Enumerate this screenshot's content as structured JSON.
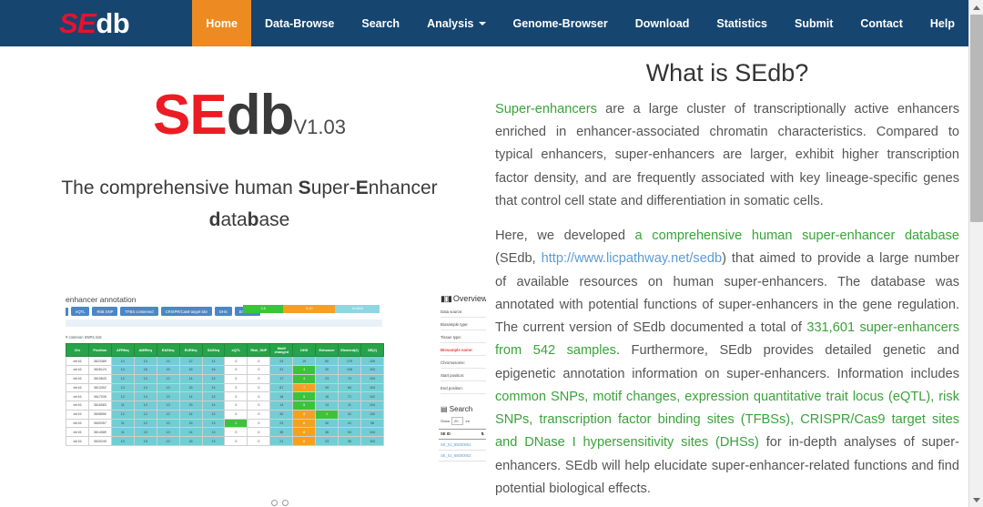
{
  "navbar": {
    "brand": {
      "part1": "SE",
      "part2": "db"
    },
    "items": [
      {
        "label": "Home",
        "active": true,
        "caret": false
      },
      {
        "label": "Data-Browse",
        "active": false,
        "caret": false
      },
      {
        "label": "Search",
        "active": false,
        "caret": false
      },
      {
        "label": "Analysis",
        "active": false,
        "caret": true
      },
      {
        "label": "Genome-Browser",
        "active": false,
        "caret": false
      },
      {
        "label": "Download",
        "active": false,
        "caret": false
      },
      {
        "label": "Statistics",
        "active": false,
        "caret": false
      },
      {
        "label": "Submit",
        "active": false,
        "caret": false
      },
      {
        "label": "Contact",
        "active": false,
        "caret": false
      },
      {
        "label": "Help",
        "active": false,
        "caret": false
      }
    ],
    "colors": {
      "background": "#164570",
      "active": "#ed8b22",
      "brand_red": "#e8112d"
    }
  },
  "hero": {
    "logo": {
      "se": "SE",
      "db": "db",
      "version": "V1.03"
    },
    "tagline_line1_a": "The comprehensive human ",
    "tagline_line1_s": "S",
    "tagline_line1_b": "uper-",
    "tagline_line1_e": "E",
    "tagline_line1_c": "nhancer",
    "tagline_line2_d": "d",
    "tagline_line2_a": "ata",
    "tagline_line2_b": "b",
    "tagline_line2_c": "ase",
    "colors": {
      "se_red": "#ec1c24",
      "db_dark": "#3a3a3a"
    }
  },
  "carousel_shot": {
    "title": "enhancer annotation",
    "tabs": [
      "eQTL",
      "Risk SNP",
      "TFBS conserved",
      "CRISPR/Cas9 target site",
      "DHS",
      "Enhancer"
    ],
    "legend": [
      {
        "label": "0-5",
        "color": "#3bc43b"
      },
      {
        "label": "5-10",
        "color": "#f5a020"
      },
      {
        "label": "10-MAX",
        "color": "#8fd6e2"
      }
    ],
    "subtitle": "# common SNPs:416",
    "table": {
      "headers": [
        "Chr",
        "Position",
        "AFRfeq",
        "AMRfeq",
        "EASfeq",
        "EURfeq",
        "SASfeq",
        "eQTL",
        "Risk_SNP",
        "Motif changed",
        "DHS",
        "Enhancer",
        "Element(#)",
        "SE(#)"
      ],
      "rows": [
        [
          "chr16",
          "3623389",
          "14",
          "14",
          "14",
          "12",
          "14",
          "0",
          "0",
          "24",
          "19",
          "60",
          "179",
          "109"
        ],
        [
          "chr16",
          "3626123",
          "14",
          "16",
          "15",
          "16",
          "16",
          "0",
          "0",
          "31",
          "4",
          "30",
          "148",
          "103"
        ],
        [
          "chr16",
          "3615843",
          "12",
          "13",
          "12",
          "14",
          "13",
          "0",
          "0",
          "17",
          "4",
          "23",
          "74",
          "104"
        ],
        [
          "chr16",
          "3613302",
          "13",
          "14",
          "13",
          "15",
          "14",
          "0",
          "0",
          "67",
          "7",
          "39",
          "84",
          "104"
        ],
        [
          "chr16",
          "3617035",
          "12",
          "14",
          "13",
          "14",
          "13",
          "0",
          "0",
          "18",
          "5",
          "18",
          "71",
          "102"
        ],
        [
          "chr16",
          "3616083",
          "11",
          "13",
          "13",
          "15",
          "14",
          "0",
          "0",
          "14",
          "5",
          "14",
          "11",
          "104"
        ],
        [
          "chr16",
          "3608550",
          "12",
          "12",
          "12",
          "14",
          "12",
          "0",
          "0",
          "40",
          "8",
          "1",
          "41",
          "100"
        ],
        [
          "chr16",
          "3609357",
          "11",
          "12",
          "13",
          "15",
          "13",
          "2",
          "0",
          "23",
          "8",
          "30",
          "41",
          "98"
        ],
        [
          "chr16",
          "3614089",
          "11",
          "13",
          "13",
          "14",
          "13",
          "0",
          "0",
          "35",
          "8",
          "36",
          "94",
          "104"
        ],
        [
          "chr16",
          "3620249",
          "10",
          "15",
          "13",
          "16",
          "13",
          "0",
          "0",
          "21",
          "6",
          "23",
          "96",
          "104"
        ]
      ]
    },
    "overview": {
      "title": "Overview",
      "fields": [
        "Data source:",
        "Biosample type:",
        "Tissue type:",
        "Biosample name:",
        "Chromosome:",
        "Start position:",
        "End position:"
      ],
      "highlight_field": "Biosample name:"
    },
    "search_panel": {
      "title": "Search",
      "show_label": "Show",
      "show_value": "20",
      "entries_label": "en",
      "column_header": "SE ID",
      "rows": [
        "SE_01_85000001",
        "SE_01_85000002"
      ]
    }
  },
  "article": {
    "title": "What is SEdb?",
    "p1": [
      {
        "t": "Super-enhancers",
        "c": "green"
      },
      {
        "t": " are a large cluster of transcriptionally active enhancers enriched in enhancer-associated chromatin characteristics. Compared to typical enhancers, super-enhancers are larger, exhibit higher transcription factor density, and are frequently associated with key lineage-specific genes that control cell state and differentiation in somatic cells.",
        "c": "plain"
      }
    ],
    "p2": [
      {
        "t": "Here, we developed ",
        "c": "plain"
      },
      {
        "t": "a comprehensive human super-enhancer database",
        "c": "green"
      },
      {
        "t": " (SEdb, ",
        "c": "plain"
      },
      {
        "t": "http://www.licpathway.net/sedb",
        "c": "link"
      },
      {
        "t": ") that aimed to provide a large number of available resources on human super-enhancers. The database was annotated with potential functions of super-enhancers in the gene regulation. The current version of SEdb documented a total of ",
        "c": "plain"
      },
      {
        "t": "331,601 super-enhancers from 542 samples",
        "c": "green"
      },
      {
        "t": ". Furthermore, SEdb provides detailed genetic and epigenetic annotation information on super-enhancers. Information includes ",
        "c": "plain"
      },
      {
        "t": "common SNPs, motif changes, expression quantitative trait locus (eQTL), risk SNPs, transcription factor binding sites (TFBSs), CRISPR/Cas9 target sites and DNase I hypersensitivity sites (DHSs)",
        "c": "green"
      },
      {
        "t": " for in-depth analyses of super-enhancers. SEdb will help elucidate super-enhancer-related functions and find potential biological effects.",
        "c": "plain"
      }
    ],
    "colors": {
      "green": "#3aa33a",
      "link": "#5b9bd5",
      "text": "#555555"
    }
  },
  "scrollbar": {
    "up_icon": "scroll-up-arrow",
    "down_icon": "scroll-down-arrow"
  }
}
